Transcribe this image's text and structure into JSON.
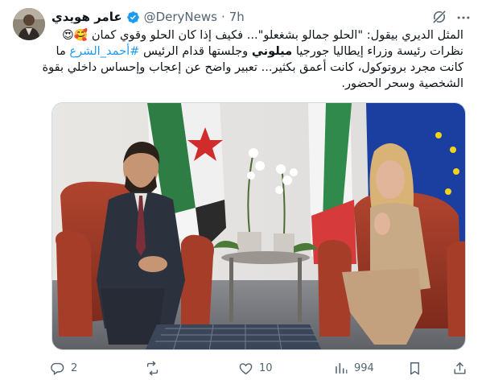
{
  "author": {
    "name": "عامر هويدي",
    "handle": "@DeryNews",
    "separator": "·",
    "time": "7h"
  },
  "tweet": {
    "line1_start": "المثل الديري بيقول: \"الحلو جمالو بشغعلو\"... فكيف إذا كان الحلو وقوي كمان",
    "line1_emoji": "🥰😍",
    "line2_start": "نظرات رئيسة وزراء إيطاليا جورجيا",
    "line2_bold": "ميلوني",
    "line2_mid": "وجلستها قدام الرئيس",
    "line2_hashtag": "#أحمد_الشرع",
    "line2_end": "ما",
    "line3": "كانت مجرد بروتوكول، كانت أعمق بكثير... تعبير واضح عن إعجاب وإحساس داخلي بقوة",
    "line4": "الشخصية وسحر الحضور."
  },
  "stats": {
    "replies": "2",
    "reposts": "",
    "likes": "10",
    "views": "994"
  },
  "icons": {
    "verified": "verified-badge-icon",
    "grok": "grok-icon",
    "more": "more-icon",
    "reply": "reply-icon",
    "repost": "repost-icon",
    "like": "like-icon",
    "views": "views-icon",
    "bookmark": "bookmark-icon",
    "share": "share-icon"
  },
  "colors": {
    "accent": "#1d9bf0",
    "muted": "#536471",
    "text": "#0f1419"
  }
}
